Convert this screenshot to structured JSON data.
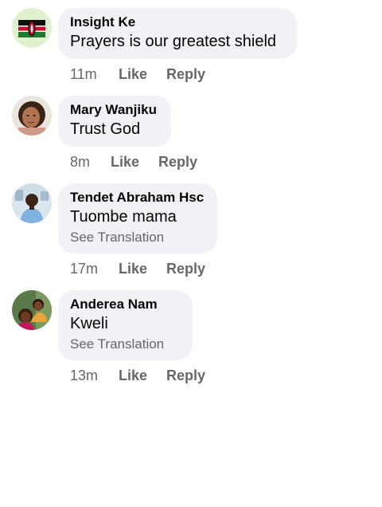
{
  "comments": [
    {
      "author": "Insight Ke",
      "text": "Prayers is our greatest shield",
      "time": "11m",
      "like": "Like",
      "reply": "Reply",
      "avatar_icon": "kenya-flag-avatar"
    },
    {
      "author": "Mary Wanjiku",
      "text": "Trust God",
      "time": "8m",
      "like": "Like",
      "reply": "Reply",
      "avatar_icon": "user-photo-avatar"
    },
    {
      "author": "Tendet Abraham Hsc",
      "text": "Tuombe mama",
      "see_translation": "See Translation",
      "time": "17m",
      "like": "Like",
      "reply": "Reply",
      "avatar_icon": "user-photo-avatar"
    },
    {
      "author": "Anderea Nam",
      "text": "Kweli",
      "see_translation": "See Translation",
      "time": "13m",
      "like": "Like",
      "reply": "Reply",
      "avatar_icon": "user-photo-avatar"
    }
  ],
  "colors": {
    "bubble": "#f0f2f5",
    "secondary_text": "#65676b",
    "primary_text": "#050505"
  }
}
